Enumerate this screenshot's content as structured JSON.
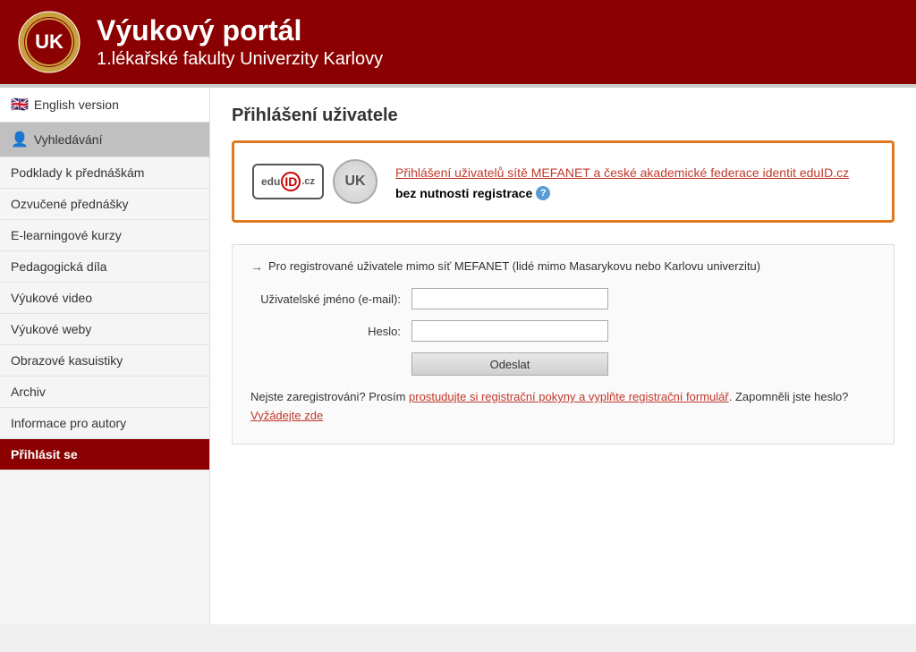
{
  "header": {
    "title_line1": "Výukový portál",
    "title_line2": "1.lékařské fakulty Univerzity Karlovy"
  },
  "sidebar": {
    "items": [
      {
        "id": "english",
        "label": "English version",
        "type": "english",
        "icon": "flag"
      },
      {
        "id": "search",
        "label": "Vyhledávání",
        "type": "search",
        "icon": "person"
      },
      {
        "id": "podklady",
        "label": "Podklady k přednáškám",
        "type": "normal"
      },
      {
        "id": "ozvucene",
        "label": "Ozvučené přednášky",
        "type": "normal"
      },
      {
        "id": "elearning",
        "label": "E-learningové kurzy",
        "type": "normal"
      },
      {
        "id": "pedagogicka",
        "label": "Pedagogická díla",
        "type": "normal"
      },
      {
        "id": "vyukove-video",
        "label": "Výukové video",
        "type": "normal"
      },
      {
        "id": "vyukove-weby",
        "label": "Výukové weby",
        "type": "normal"
      },
      {
        "id": "obrazove",
        "label": "Obrazové kasuistiky",
        "type": "normal"
      },
      {
        "id": "archiv",
        "label": "Archiv",
        "type": "normal"
      },
      {
        "id": "informace",
        "label": "Informace pro autory",
        "type": "normal"
      },
      {
        "id": "prihlasit",
        "label": "Přihlásit se",
        "type": "active"
      }
    ]
  },
  "main": {
    "page_title": "Přihlášení uživatele",
    "orange_box": {
      "link_text": "Přihlášení uživatelů sítě MEFANET a české akademické federace identit eduID.cz",
      "sub_text": "bez nutnosti registrace"
    },
    "form": {
      "intro_text": "Pro registrované uživatele mimo síť MEFANET (lidé mimo Masarykovu nebo Karlovu univerzitu)",
      "username_label": "Uživatelské jméno (e-mail):",
      "password_label": "Heslo:",
      "submit_label": "Odeslat",
      "footer_not_registered": "Nejste zaregistrováni?",
      "footer_please": "Prosím",
      "footer_link1": "prostudujte si registrační pokyny a vyplňte registrační formulář",
      "footer_forgot": "Zapomněli jste heslo?",
      "footer_link2": "Vyžádejte zde"
    },
    "edu_id_label": "edu ID .cz",
    "uk_label": "UK"
  }
}
